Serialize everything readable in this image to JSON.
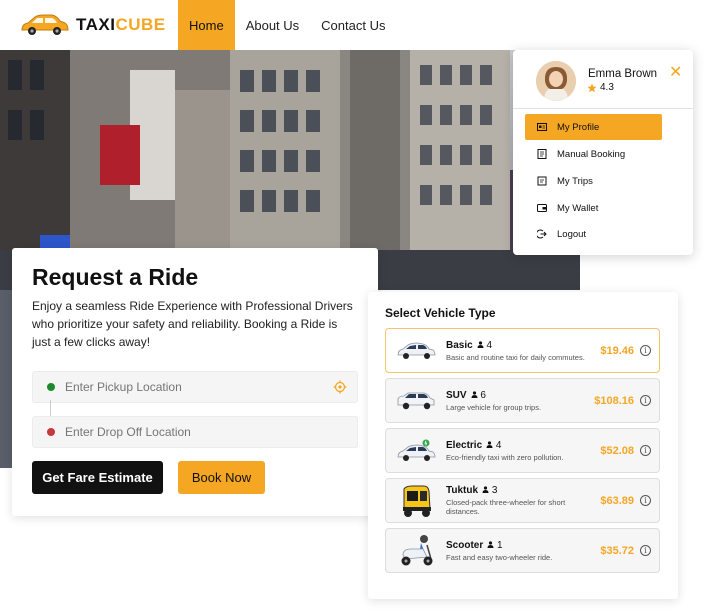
{
  "brand": {
    "part1": "TAXI",
    "part2": "CUBE",
    "accent": "#f5a623"
  },
  "nav": [
    {
      "label": "Home",
      "active": true
    },
    {
      "label": "About Us",
      "active": false
    },
    {
      "label": "Contact Us",
      "active": false
    }
  ],
  "ride": {
    "title": "Request a Ride",
    "subtitle": "Enjoy a seamless Ride Experience with Professional Drivers who prioritize your safety and reliability. Booking a Ride is just a few clicks away!",
    "pickup_placeholder": "Enter Pickup Location",
    "dropoff_placeholder": "Enter Drop Off Location",
    "estimate_label": "Get Fare Estimate",
    "book_label": "Book Now"
  },
  "vehicles": {
    "title": "Select Vehicle Type",
    "items": [
      {
        "name": "Basic",
        "seats": "4",
        "desc": "Basic and routine taxi for daily commutes.",
        "price": "$19.46",
        "selected": true,
        "icon": "sedan-icon"
      },
      {
        "name": "SUV",
        "seats": "6",
        "desc": "Large vehicle for group trips.",
        "price": "$108.16",
        "selected": false,
        "icon": "suv-icon"
      },
      {
        "name": "Electric",
        "seats": "4",
        "desc": "Eco-friendly taxi with zero pollution.",
        "price": "$52.08",
        "selected": false,
        "icon": "electric-car-icon"
      },
      {
        "name": "Tuktuk",
        "seats": "3",
        "desc": "Closed-pack three-wheeler for short distances.",
        "price": "$63.89",
        "selected": false,
        "icon": "tuktuk-icon"
      },
      {
        "name": "Scooter",
        "seats": "1",
        "desc": "Fast and easy two-wheeler ride.",
        "price": "$35.72",
        "selected": false,
        "icon": "scooter-icon"
      }
    ]
  },
  "profile": {
    "name": "Emma Brown",
    "rating": "4.3",
    "menu": [
      {
        "label": "My Profile",
        "active": true,
        "icon": "profile-card-icon"
      },
      {
        "label": "Manual Booking",
        "active": false,
        "icon": "booking-icon"
      },
      {
        "label": "My Trips",
        "active": false,
        "icon": "trips-icon"
      },
      {
        "label": "My Wallet",
        "active": false,
        "icon": "wallet-icon"
      },
      {
        "label": "Logout",
        "active": false,
        "icon": "logout-icon"
      }
    ]
  }
}
